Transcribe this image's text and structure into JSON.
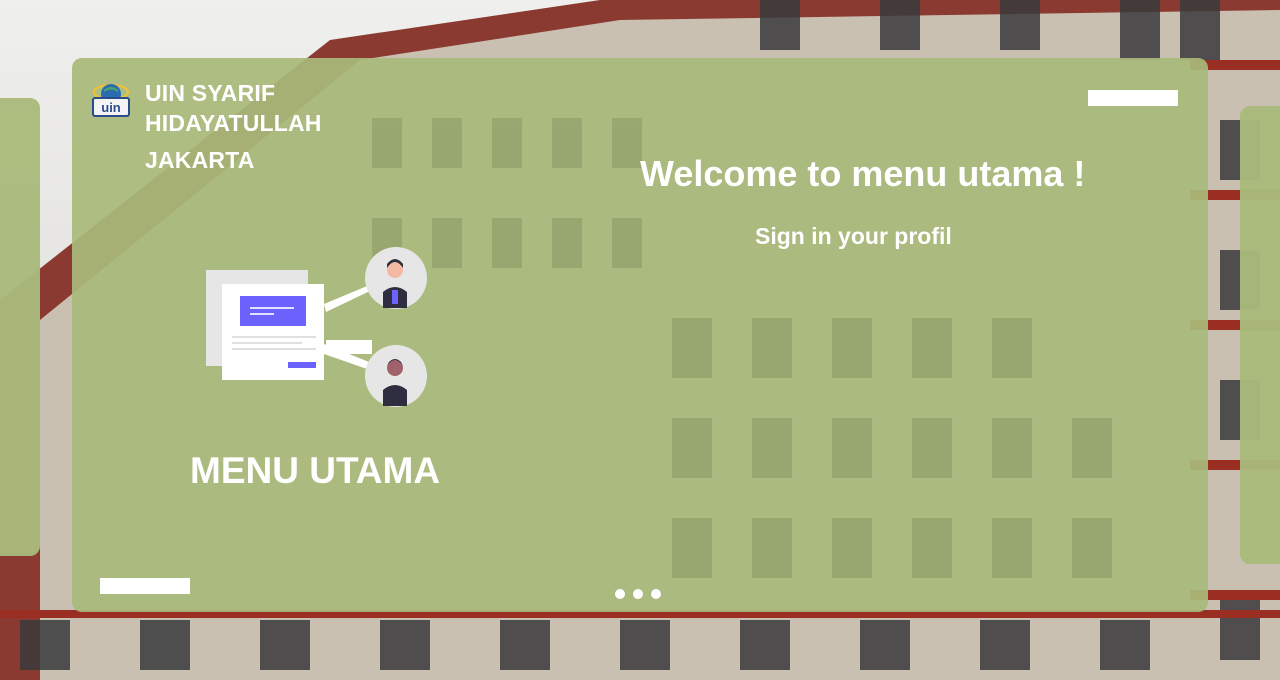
{
  "brand": {
    "line1": "UIN SYARIF",
    "line2": "HIDAYATULLAH",
    "line3": "JAKARTA",
    "logo_text": "uin"
  },
  "main": {
    "menu_title": "MENU UTAMA",
    "welcome": "Welcome to menu utama !",
    "subtitle": "Sign in your profil"
  },
  "icons": [
    "uin-logo-icon",
    "menu-illustration-icon"
  ],
  "colors": {
    "panel": "#a9b97a",
    "text": "#ffffff",
    "accent": "#6c63ff"
  }
}
